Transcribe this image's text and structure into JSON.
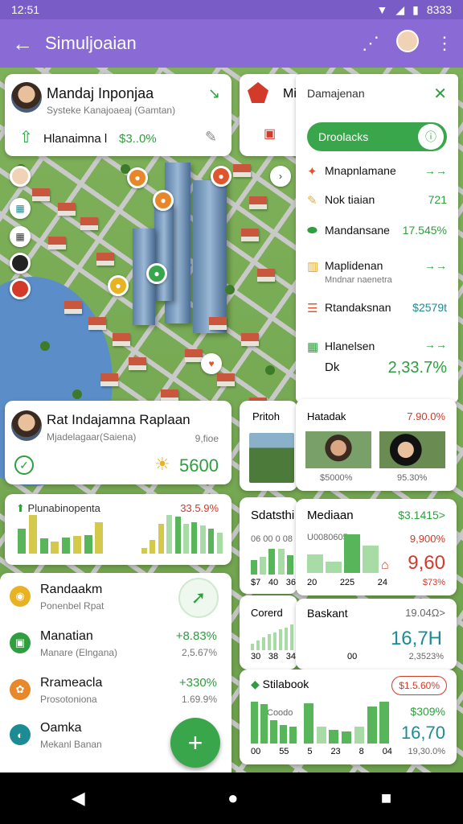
{
  "status": {
    "time": "12:51",
    "battery": "83%",
    "battery_display": "8333"
  },
  "appbar": {
    "title": "Simuljoaian",
    "back_icon": "arrow-left-icon",
    "share_icon": "share-icon",
    "more_icon": "more-vert-icon"
  },
  "profile_card": {
    "name": "Mandaj Inponjaa",
    "subtitle": "Systeke Kanajoaeaj (Gamtan)",
    "row_label": "Hlanaimna l",
    "row_value": "$3..0%"
  },
  "mini_card": {
    "label": "Mi"
  },
  "side_panel": {
    "title": "Damajenan",
    "pill_label": "Droolacks",
    "items": [
      {
        "label": "Mnapnlamane",
        "value": "",
        "color": "#e0552e"
      },
      {
        "label": "Nok tiaian",
        "value": "721",
        "color": "#e8b222"
      },
      {
        "label": "Mandansane",
        "value": "17.545%",
        "color": "#2e9e3e"
      },
      {
        "label": "Maplidenan",
        "sub": "Mndnar naenetra",
        "value": "",
        "color": "#e8a822"
      },
      {
        "label": "Rtandaksnan",
        "value": "$2579t",
        "color": "#e0552e"
      },
      {
        "label": "Hlanelsen",
        "sub2": "Dk",
        "value": "2,33.7%",
        "color": "#2e9e3e"
      }
    ]
  },
  "person_card": {
    "name": "Rat Indajamna Raplaan",
    "subtitle": "Mjadelagaar(Saiena)",
    "meta": "9,fioe",
    "value": "5600"
  },
  "chart_card_1": {
    "title": "Plunabinopenta",
    "value": "33.5.9%",
    "bars_left": [
      40,
      62,
      24,
      20,
      26,
      28,
      30,
      50
    ],
    "bars_right": [
      8,
      18,
      40,
      52,
      50,
      40,
      42,
      38,
      34,
      28
    ]
  },
  "list_card": {
    "items": [
      {
        "label": "Randaakm",
        "sub": "Ponenbel Rpat",
        "value": "",
        "sub_value": "",
        "color": "#e8b222"
      },
      {
        "label": "Manatian",
        "sub": "Manare (Elngana)",
        "value": "+8.83%",
        "sub_value": "2,5.67%",
        "color": "#2e9e3e"
      },
      {
        "label": "Rrameacla",
        "sub": "Prosotoniona",
        "value": "+330%",
        "sub_value": "1.69.9%",
        "color": "#e8882a"
      },
      {
        "label": "Oamka",
        "sub": "Mekanl Banan",
        "value": "",
        "sub_value": "",
        "color": "#1c8c94"
      }
    ]
  },
  "photo_card_a": {
    "title": "Pritoh"
  },
  "photo_card_b": {
    "title": "Hatadak",
    "value": "7.90.0%",
    "cap_left": "$5000%",
    "cap_right": "95.30%"
  },
  "stat_card_a": {
    "title": "Sdatsthi",
    "sub": "06 00 0 08",
    "ticks": [
      "$7",
      "40",
      "36"
    ],
    "bars": [
      22,
      28,
      40,
      40,
      30
    ]
  },
  "stat_card_b": {
    "title": "Mediaan",
    "value": "$3.1415>",
    "sub": "U0080605",
    "sub_value": "9,900%",
    "big": "9,60",
    "pct": "$73%",
    "ticks": [
      "20",
      "225",
      "24"
    ],
    "bars": [
      20,
      12,
      42,
      30
    ]
  },
  "stat_card_c": {
    "title": "Corerd",
    "bars": [
      8,
      12,
      16,
      20,
      22,
      26,
      28,
      32
    ],
    "ticks": [
      "30",
      "38",
      "34"
    ]
  },
  "stat_card_d": {
    "title": "Baskant",
    "value": "19.04Ω>",
    "big": "16,7H",
    "sub_value": "2,3523%",
    "ticks": [
      "00"
    ]
  },
  "stat_card_e": {
    "title": "Stilabook",
    "badge": "$1.5.60%",
    "sub": "Coodo",
    "value": "$309%",
    "big": "16,70",
    "sub_value": "19,30.0%",
    "ticks": [
      "00",
      "55",
      "5",
      "23",
      "8",
      "04"
    ],
    "bars_left": [
      40,
      38,
      22,
      18,
      16
    ],
    "bars_right": [
      48,
      20,
      16,
      14,
      20,
      44,
      50
    ]
  },
  "fab": {
    "label": "+"
  },
  "nav": {
    "back": "◀",
    "home": "●",
    "recent": "■"
  },
  "colors": {
    "appbar": "#8a6ad4",
    "accent": "#2e9e3e",
    "warn": "#d23a2a"
  }
}
